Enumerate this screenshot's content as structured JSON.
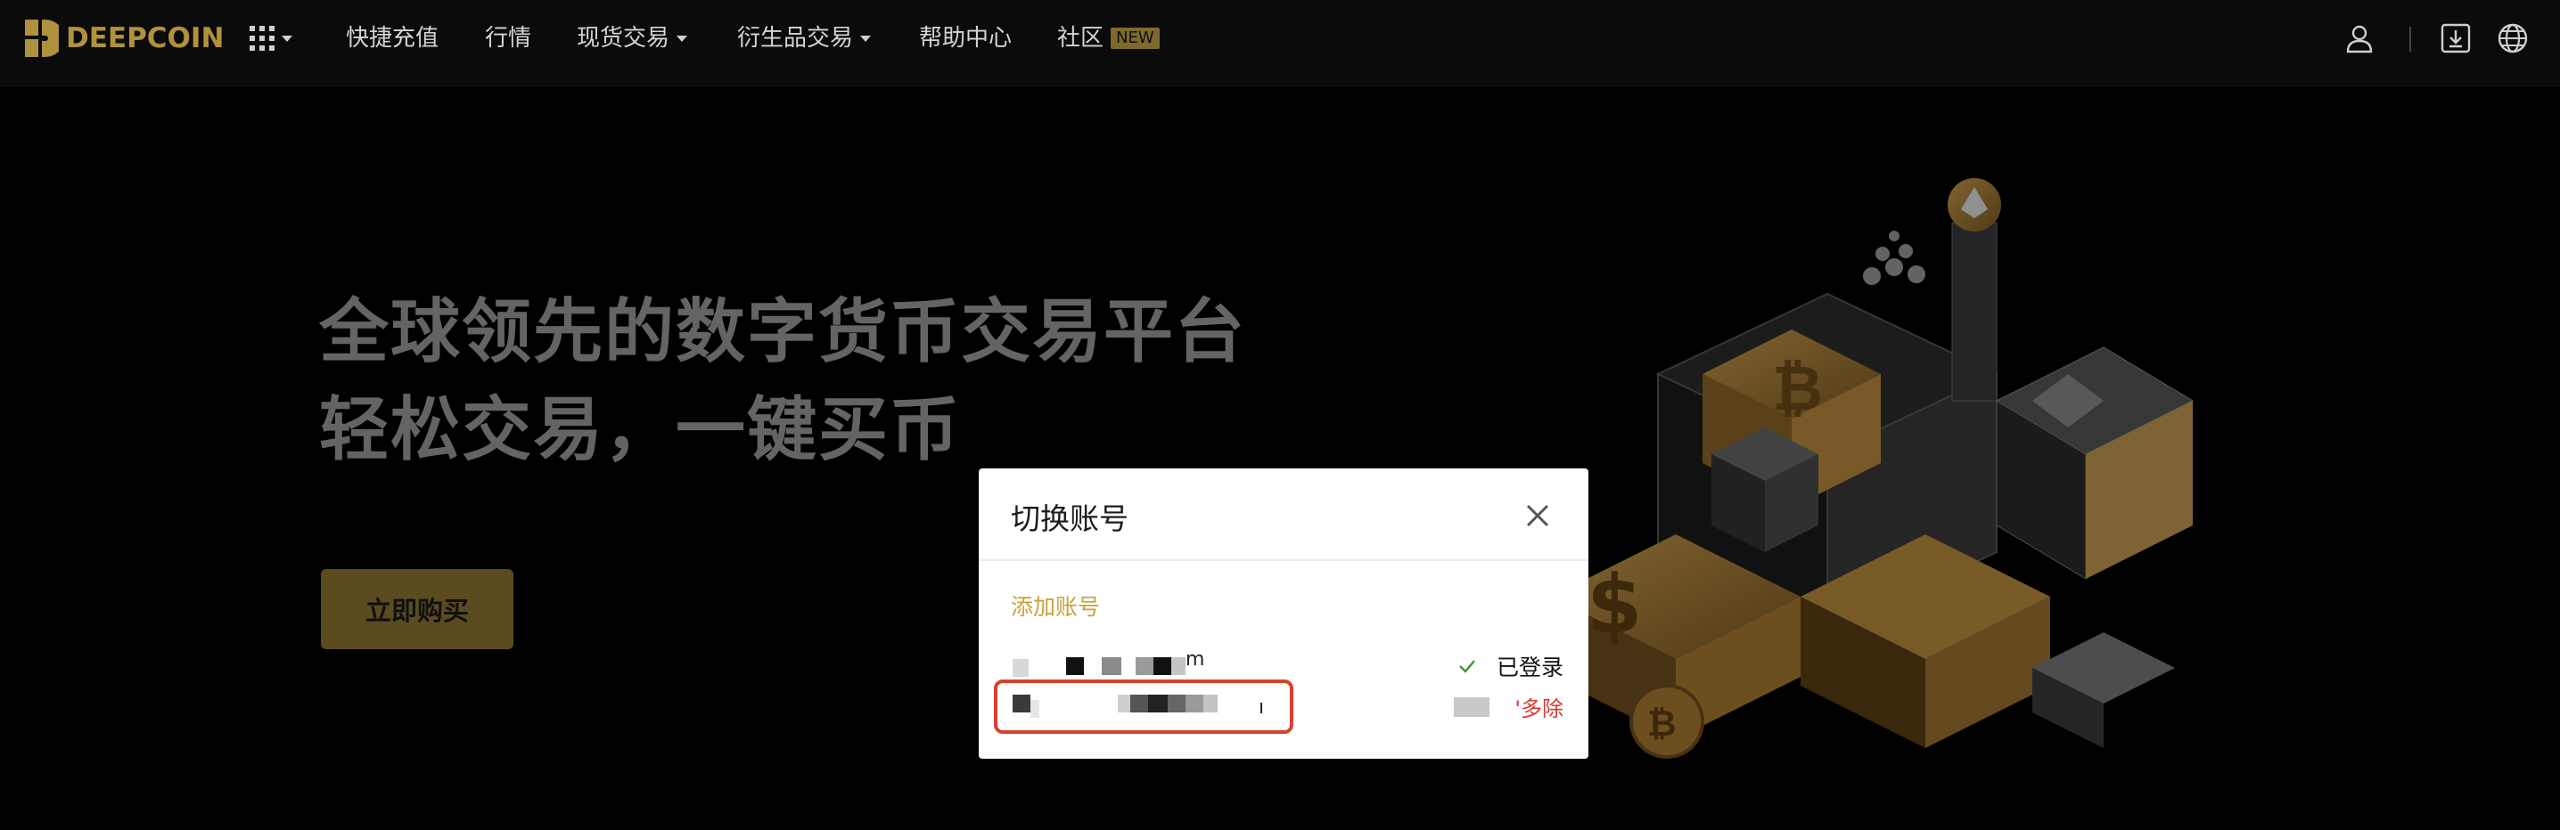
{
  "nav": {
    "logo_text": "DEEPCOIN",
    "items": [
      {
        "label": "快捷充值"
      },
      {
        "label": "行情"
      },
      {
        "label": "现货交易"
      },
      {
        "label": "衍生品交易"
      },
      {
        "label": "帮助中心"
      },
      {
        "label": "社区",
        "badge": "NEW"
      }
    ],
    "icons": [
      "user-icon",
      "download-icon",
      "globe-icon"
    ]
  },
  "hero": {
    "line1": "全球领先的数字货币交易平台",
    "line2": "轻松交易，一键买币",
    "buy_button": "立即购买"
  },
  "modal": {
    "title": "切换账号",
    "add_account": "添加账号",
    "accounts": [
      {
        "tail": "m",
        "status": "已登录"
      },
      {
        "tail": "ı",
        "action": "移除",
        "action_shown": "'多除"
      }
    ]
  },
  "colors": {
    "brand_gold": "#b0913e",
    "button_gold": "#8a7530",
    "link_gold": "#c9a23a",
    "danger_red": "#d8392e",
    "highlight_red": "#d9412f"
  }
}
